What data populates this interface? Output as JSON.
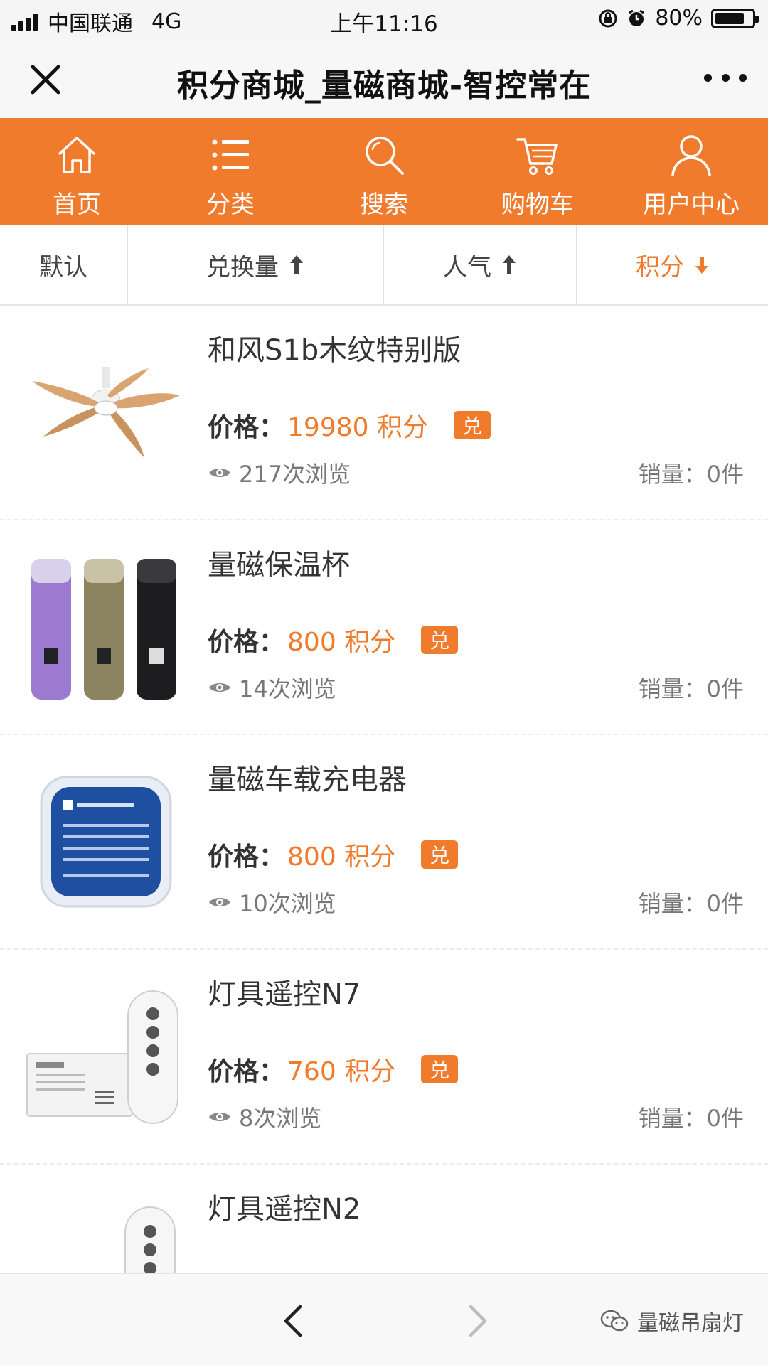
{
  "status_bar": {
    "carrier": "中国联通",
    "network": "4G",
    "time": "上午11:16",
    "battery": "80%",
    "battery_level": 0.8
  },
  "title_bar": {
    "title": "积分商城_量磁商城-智控常在",
    "close_icon": "close-icon",
    "more_icon": "more-icon"
  },
  "nav": {
    "items": [
      {
        "label": "首页",
        "icon": "home-icon"
      },
      {
        "label": "分类",
        "icon": "list-icon"
      },
      {
        "label": "搜索",
        "icon": "search-icon"
      },
      {
        "label": "购物车",
        "icon": "cart-icon"
      },
      {
        "label": "用户中心",
        "icon": "user-icon"
      }
    ]
  },
  "sort": {
    "items": [
      {
        "label": "默认",
        "direction": "none"
      },
      {
        "label": "兑换量",
        "direction": "up"
      },
      {
        "label": "人气",
        "direction": "up"
      },
      {
        "label": "积分",
        "direction": "down",
        "active": true
      }
    ]
  },
  "products": [
    {
      "name": "和风S1b木纹特别版",
      "price_label": "价格：",
      "price": "19980 积分",
      "badge": "兑",
      "views": "217次浏览",
      "sales": "销量：0件",
      "image": "ceiling-fan"
    },
    {
      "name": "量磁保温杯",
      "price_label": "价格：",
      "price": "800 积分",
      "badge": "兑",
      "views": "14次浏览",
      "sales": "销量：0件",
      "image": "thermos-cups"
    },
    {
      "name": "量磁车载充电器",
      "price_label": "价格：",
      "price": "800 积分",
      "badge": "兑",
      "views": "10次浏览",
      "sales": "销量：0件",
      "image": "car-charger"
    },
    {
      "name": "灯具遥控N7",
      "price_label": "价格：",
      "price": "760 积分",
      "badge": "兑",
      "views": "8次浏览",
      "sales": "销量：0件",
      "image": "remote-n7"
    },
    {
      "name": "灯具遥控N2",
      "image": "remote-n2"
    }
  ],
  "bottom_bar": {
    "watermark": "量磁吊扇灯"
  },
  "colors": {
    "accent": "#f07b2c",
    "text": "#333333",
    "muted": "#777777"
  }
}
